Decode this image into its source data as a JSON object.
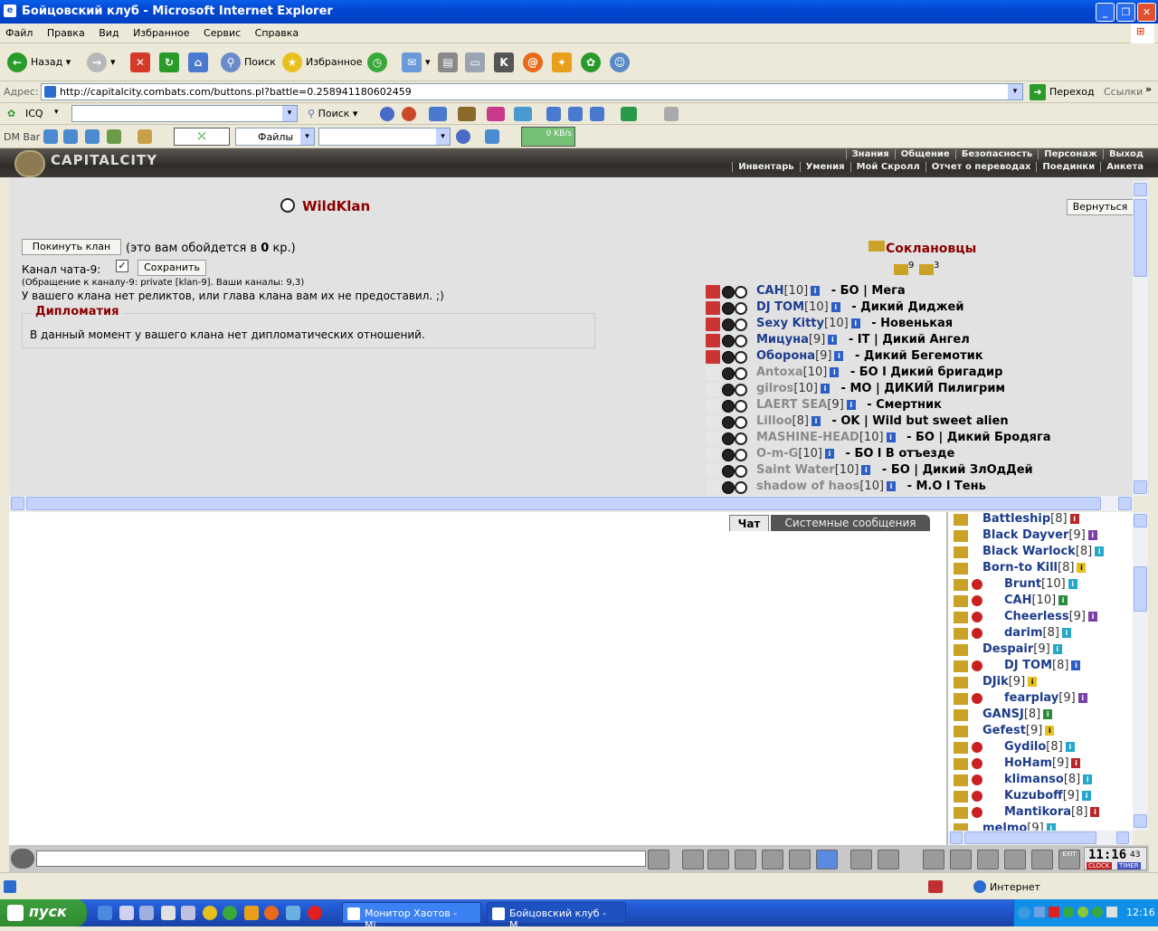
{
  "window": {
    "title": "Бойцовский клуб - Microsoft Internet Explorer"
  },
  "menu": [
    "Файл",
    "Правка",
    "Вид",
    "Избранное",
    "Сервис",
    "Справка"
  ],
  "toolbar": {
    "back": "Назад",
    "search": "Поиск",
    "favorites": "Избранное"
  },
  "address": {
    "label": "Адрес:",
    "url": "http://capitalcity.combats.com/buttons.pl?battle=0.258941180602459",
    "go": "Переход",
    "links": "Ссылки"
  },
  "bar3": {
    "icq": "ICQ",
    "search": "Поиск"
  },
  "bar4": {
    "dmbar": "DM Bar",
    "files": "Файлы",
    "speed": "0 KB/s"
  },
  "site": {
    "logo": "CAPITALCITY",
    "nav_top": [
      "Знания",
      "Общение",
      "Безопасность",
      "Персонаж",
      "Выход"
    ],
    "nav_bottom": [
      "Инвентарь",
      "Умения",
      "Мой Скролл",
      "Отчет о переводах",
      "Поединки",
      "Анкета"
    ]
  },
  "clan": {
    "name": "WildKlan",
    "back_button": "Вернуться",
    "leave_button": "Покинуть клан",
    "leave_cost_prefix": "(это вам обойдется в ",
    "leave_cost_value": "0",
    "leave_cost_suffix": " кр.)",
    "channel_label": "Канал чата-9:",
    "save_button": "Сохранить",
    "channel_info": "(Обращение к каналу-9: private [klan-9]. Ваши каналы: 9,3)",
    "relics_text": "У вашего клана нет реликтов, или глава клана вам их не предоставил. ;)",
    "diplomacy_title": "Дипломатия",
    "diplomacy_text": "В данный момент у вашего клана нет дипломатических отношений.",
    "members_title": "Соклановцы",
    "count_a": "9",
    "count_b": "3",
    "members": [
      {
        "name": "САН",
        "level": "[10]",
        "status": "- БО | Мега",
        "online": true
      },
      {
        "name": "DJ TOM",
        "level": "[10]",
        "status": "- Дикий Диджей",
        "online": true
      },
      {
        "name": "Sexy Kitty",
        "level": "[10]",
        "status": "- Новенькая",
        "online": true
      },
      {
        "name": "Мицуна",
        "level": "[9]",
        "status": "- IT | Дикий Ангел",
        "online": true
      },
      {
        "name": "Оборона",
        "level": "[9]",
        "status": "- Дикий Бегемотик",
        "online": true
      },
      {
        "name": "Antoxa",
        "level": "[10]",
        "status": "- БО l Дикий бригадир",
        "online": false
      },
      {
        "name": "gilros",
        "level": "[10]",
        "status": "- МО | ДИКИЙ Пилигрим",
        "online": false
      },
      {
        "name": "LAERT SEA",
        "level": "[9]",
        "status": "- Смертник",
        "online": false
      },
      {
        "name": "Lilloo",
        "level": "[8]",
        "status": "- OK | Wild but sweet alien",
        "online": false
      },
      {
        "name": "MASHINE-HEAD",
        "level": "[10]",
        "status": "- БО | Дикий Бродяга",
        "online": false
      },
      {
        "name": "O-m-G",
        "level": "[10]",
        "status": "- БО l В отъезде",
        "online": false
      },
      {
        "name": "Saint Water",
        "level": "[10]",
        "status": "- БО | Дикий ЗлОдДей",
        "online": false
      },
      {
        "name": "shadow of haos",
        "level": "[10]",
        "status": "- М.О l Тень",
        "online": false
      }
    ]
  },
  "chat": {
    "tab_chat": "Чат",
    "tab_system": "Системные сообщения"
  },
  "online_list": [
    {
      "name": "Battleship",
      "level": "[8]",
      "badge": "r",
      "indent": false
    },
    {
      "name": "Black Dayver",
      "level": "[9]",
      "badge": "p",
      "indent": false
    },
    {
      "name": "Black Warlock",
      "level": "[8]",
      "badge": "c",
      "indent": false
    },
    {
      "name": "Born-to Kill",
      "level": "[8]",
      "badge": "y",
      "indent": false
    },
    {
      "name": "Brunt",
      "level": "[10]",
      "badge": "c",
      "indent": true
    },
    {
      "name": "САН",
      "level": "[10]",
      "badge": "g",
      "indent": true
    },
    {
      "name": "Cheerless",
      "level": "[9]",
      "badge": "p",
      "indent": true
    },
    {
      "name": "darim",
      "level": "[8]",
      "badge": "c",
      "indent": true
    },
    {
      "name": "Despair",
      "level": "[9]",
      "badge": "c",
      "indent": false
    },
    {
      "name": "DJ TOM",
      "level": "[8]",
      "badge": "b",
      "indent": true
    },
    {
      "name": "DJik",
      "level": "[9]",
      "badge": "y",
      "indent": false
    },
    {
      "name": "fearplay",
      "level": "[9]",
      "badge": "p",
      "indent": true
    },
    {
      "name": "GANSJ",
      "level": "[8]",
      "badge": "g",
      "indent": false
    },
    {
      "name": "Gefest",
      "level": "[9]",
      "badge": "y",
      "indent": false
    },
    {
      "name": "Gydilo",
      "level": "[8]",
      "badge": "c",
      "indent": true
    },
    {
      "name": "HoHam",
      "level": "[9]",
      "badge": "r",
      "indent": true
    },
    {
      "name": "klimanso",
      "level": "[8]",
      "badge": "c",
      "indent": true
    },
    {
      "name": "Kuzuboff",
      "level": "[9]",
      "badge": "c",
      "indent": true
    },
    {
      "name": "Mantikora",
      "level": "[8]",
      "badge": "r",
      "indent": true
    },
    {
      "name": "melmo",
      "level": "[9]",
      "badge": "c",
      "indent": false
    }
  ],
  "clock": {
    "time": "11:16",
    "sec": "43",
    "clock_label": "CLOCK",
    "timer_label": "TIMER",
    "exit_label": "EXIT"
  },
  "status": {
    "zone": "Интернет"
  },
  "taskbar": {
    "start": "пуск",
    "task1": "Монитор Хаотов - Mi...",
    "task2": "Бойцовский клуб - M...",
    "time": "12:16"
  }
}
